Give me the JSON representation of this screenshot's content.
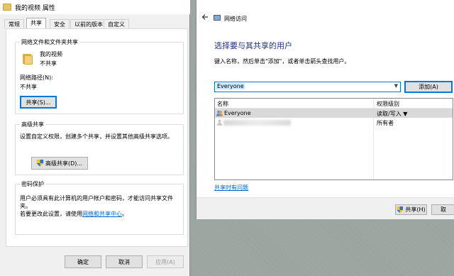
{
  "properties_dialog": {
    "title": "我的视频 属性",
    "tabs": [
      "常规",
      "共享",
      "安全",
      "以前的版本",
      "自定义"
    ],
    "active_tab": "共享",
    "file_sharing": {
      "group_title": "网络文件和文件夹共享",
      "folder_name": "我的视频",
      "folder_status": "不共享",
      "network_path_label": "网络路径(N):",
      "network_path_value": "不共享",
      "share_button": "共享(S)..."
    },
    "advanced_sharing": {
      "group_title": "高级共享",
      "description": "设置自定义权限，创建多个共享，并设置其他高级共享选项。",
      "button": "高级共享(D)..."
    },
    "password_protection": {
      "group_title": "密码保护",
      "description": "用户必须具有此计算机的用户帐户和密码，才能访问共享文件夹。",
      "change_prefix": "若要更改此设置，请使用",
      "change_link": "网络和共享中心",
      "change_suffix": "。"
    },
    "buttons": {
      "ok": "确定",
      "cancel": "取消",
      "apply": "应用(A)"
    }
  },
  "network_access_dialog": {
    "title": "网络访问",
    "heading": "选择要与其共享的用户",
    "instruction": "键入名称，然后单击\"添加\"，或者单击箭头查找用户。",
    "input_value": "Everyone",
    "add_button": "添加(A)",
    "table": {
      "columns": [
        "名称",
        "权限级别"
      ],
      "rows": [
        {
          "name": "Everyone",
          "permission": "读取/写入 ▼"
        },
        {
          "name": "",
          "permission": "所有者"
        }
      ]
    },
    "help_link": "共享时有问题",
    "share_button": "共享(H)",
    "cancel_button": "取"
  }
}
